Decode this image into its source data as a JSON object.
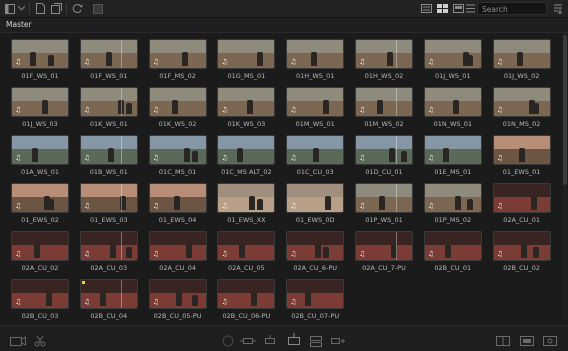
{
  "toolbar": {
    "search_placeholder": "Search",
    "icons": [
      "panel-toggle-icon",
      "dropdown-icon",
      "new-bin-icon",
      "new-smart-bin-icon",
      "sync-icon",
      "metadata-icon",
      "list-view-icon",
      "thumbnail-view-icon",
      "filmstrip-view-icon",
      "sort-icon"
    ]
  },
  "bin": {
    "title": "Master"
  },
  "clips": [
    {
      "label": "01F_WS_01",
      "look": "beach"
    },
    {
      "label": "01F_WS_01",
      "look": "beach"
    },
    {
      "label": "01F_MS_02",
      "look": "beach"
    },
    {
      "label": "01G_MS_01",
      "look": "beach"
    },
    {
      "label": "01H_WS_01",
      "look": "beach"
    },
    {
      "label": "01H_WS_02",
      "look": "beach"
    },
    {
      "label": "01J_WS_01",
      "look": "beach"
    },
    {
      "label": "01J_WS_02",
      "look": "beach"
    },
    {
      "label": "01J_WS_03",
      "look": "beach"
    },
    {
      "label": "01K_WS_01",
      "look": "beach"
    },
    {
      "label": "01K_WS_02",
      "look": "beach"
    },
    {
      "label": "01K_WS_03",
      "look": "beach"
    },
    {
      "label": "01M_WS_01",
      "look": "beach"
    },
    {
      "label": "01M_WS_02",
      "look": "beach"
    },
    {
      "label": "01N_WS_01",
      "look": "beach"
    },
    {
      "label": "01N_MS_02",
      "look": "beach"
    },
    {
      "label": "01A_WS_01",
      "look": "coast"
    },
    {
      "label": "01B_WS_01",
      "look": "coast"
    },
    {
      "label": "01C_MS_01",
      "look": "coast"
    },
    {
      "label": "01C_MS ALT_02",
      "look": "coast"
    },
    {
      "label": "01C_CU_03",
      "look": "coast"
    },
    {
      "label": "01D_CU_01",
      "look": "coast"
    },
    {
      "label": "01E_MS_01",
      "look": "coast"
    },
    {
      "label": "01_EWS_01",
      "look": "sunset"
    },
    {
      "label": "01_EWS_02",
      "look": "sunset"
    },
    {
      "label": "01_EWS_03",
      "look": "sunset"
    },
    {
      "label": "01_EWS_04",
      "look": "sunset"
    },
    {
      "label": "01_EWS_XX",
      "look": "sand"
    },
    {
      "label": "01_EWS_0D",
      "look": "sand"
    },
    {
      "label": "01P_WS_01",
      "look": "beach"
    },
    {
      "label": "01P_MS_02",
      "look": "beach"
    },
    {
      "label": "02A_CU_01",
      "look": "night"
    },
    {
      "label": "02A_CU_02",
      "look": "night"
    },
    {
      "label": "02A_CU_03",
      "look": "night"
    },
    {
      "label": "02A_CU_04",
      "look": "night"
    },
    {
      "label": "02A_CU_05",
      "look": "night"
    },
    {
      "label": "02A_CU_6-PU",
      "look": "night"
    },
    {
      "label": "02A_CU_7-PU",
      "look": "night"
    },
    {
      "label": "02B_CU_01",
      "look": "night"
    },
    {
      "label": "02B_CU_02",
      "look": "night"
    },
    {
      "label": "02B_CU_03",
      "look": "night"
    },
    {
      "label": "02B_CU_04",
      "look": "night",
      "marker": true
    },
    {
      "label": "02B_CU_05-PU",
      "look": "night"
    },
    {
      "label": "02B_CU_06-PU",
      "look": "night"
    },
    {
      "label": "02B_CU_07-PU",
      "look": "night"
    }
  ],
  "colors": {
    "beach_sky": "#8e8a7c",
    "beach_ground": "#7b6752",
    "coast_sky": "#8597a5",
    "coast_ground": "#5b6a58",
    "sunset_sky": "#b98e78",
    "sunset_ground": "#6d5544",
    "sand_sky": "#9f8f7c",
    "sand_ground": "#b8a088",
    "night_sky": "#3a2422",
    "night_ground": "#7a3c34"
  }
}
